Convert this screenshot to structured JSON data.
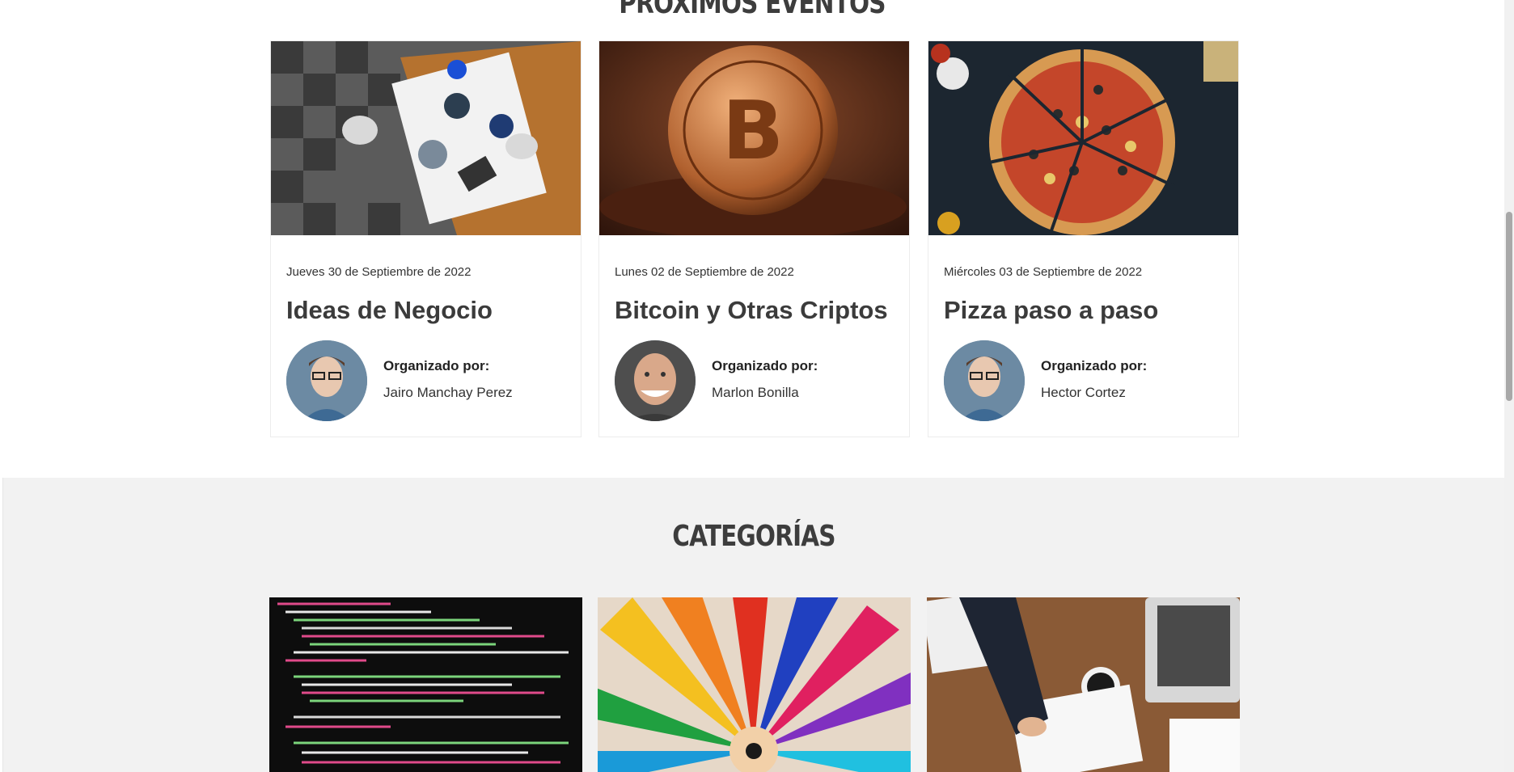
{
  "events_section": {
    "title": "PRÓXIMOS EVENTOS",
    "cards": [
      {
        "image": "business-meeting-photo",
        "date": "Jueves 30 de Septiembre de 2022",
        "title": "Ideas de Negocio",
        "organizer_label": "Organizado por:",
        "organizer_name": "Jairo Manchay Perez"
      },
      {
        "image": "bitcoin-coin-photo",
        "date": "Lunes 02 de Septiembre de 2022",
        "title": "Bitcoin y Otras Criptos",
        "organizer_label": "Organizado por:",
        "organizer_name": "Marlon Bonilla"
      },
      {
        "image": "pizza-photo",
        "date": "Miércoles 03 de Septiembre de 2022",
        "title": "Pizza paso a paso",
        "organizer_label": "Organizado por:",
        "organizer_name": "Hector Cortez"
      }
    ]
  },
  "categories_section": {
    "title": "CATEGORÍAS",
    "images": [
      "code-screen-photo",
      "colored-pencils-photo",
      "office-desk-laptop-photo"
    ]
  },
  "colors": {
    "section_alt_bg": "#f2f2f2",
    "title_text": "#3d3d3d"
  }
}
